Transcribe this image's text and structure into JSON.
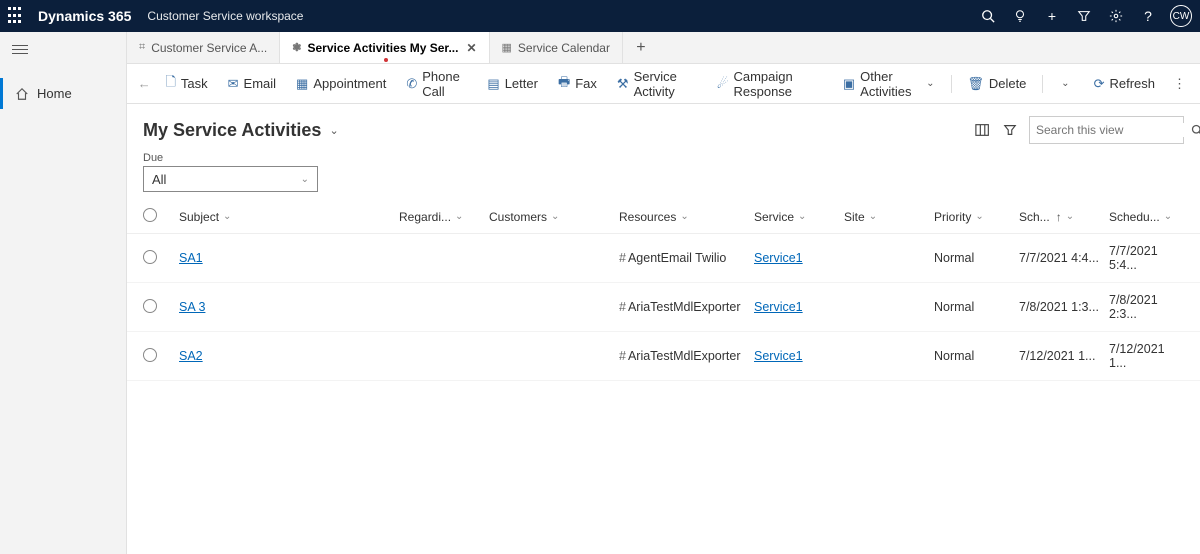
{
  "brand": "Dynamics 365",
  "workspace": "Customer Service workspace",
  "avatar": "CW",
  "sidebar": {
    "home": "Home"
  },
  "tabs": [
    {
      "label": "Customer Service A..."
    },
    {
      "label": "Service Activities My Ser..."
    },
    {
      "label": "Service Calendar"
    }
  ],
  "commands": {
    "task": "Task",
    "email": "Email",
    "appointment": "Appointment",
    "phonecall": "Phone Call",
    "letter": "Letter",
    "fax": "Fax",
    "serviceactivity": "Service Activity",
    "campaignresponse": "Campaign Response",
    "other": "Other Activities",
    "delete": "Delete",
    "refresh": "Refresh"
  },
  "view": {
    "title": "My Service Activities",
    "searchPlaceholder": "Search this view"
  },
  "due": {
    "label": "Due",
    "value": "All"
  },
  "columns": {
    "subject": "Subject",
    "regarding": "Regardi...",
    "customers": "Customers",
    "resources": "Resources",
    "service": "Service",
    "site": "Site",
    "priority": "Priority",
    "start": "Sch...",
    "end": "Schedu..."
  },
  "rows": [
    {
      "subject": "SA1",
      "resources": "AgentEmail Twilio",
      "service": "Service1",
      "priority": "Normal",
      "start": "7/7/2021 4:4...",
      "end": "7/7/2021 5:4..."
    },
    {
      "subject": "SA 3",
      "resources": "AriaTestMdlExporter",
      "service": "Service1",
      "priority": "Normal",
      "start": "7/8/2021 1:3...",
      "end": "7/8/2021 2:3..."
    },
    {
      "subject": "SA2",
      "resources": "AriaTestMdlExporter",
      "service": "Service1",
      "priority": "Normal",
      "start": "7/12/2021 1...",
      "end": "7/12/2021 1..."
    }
  ]
}
